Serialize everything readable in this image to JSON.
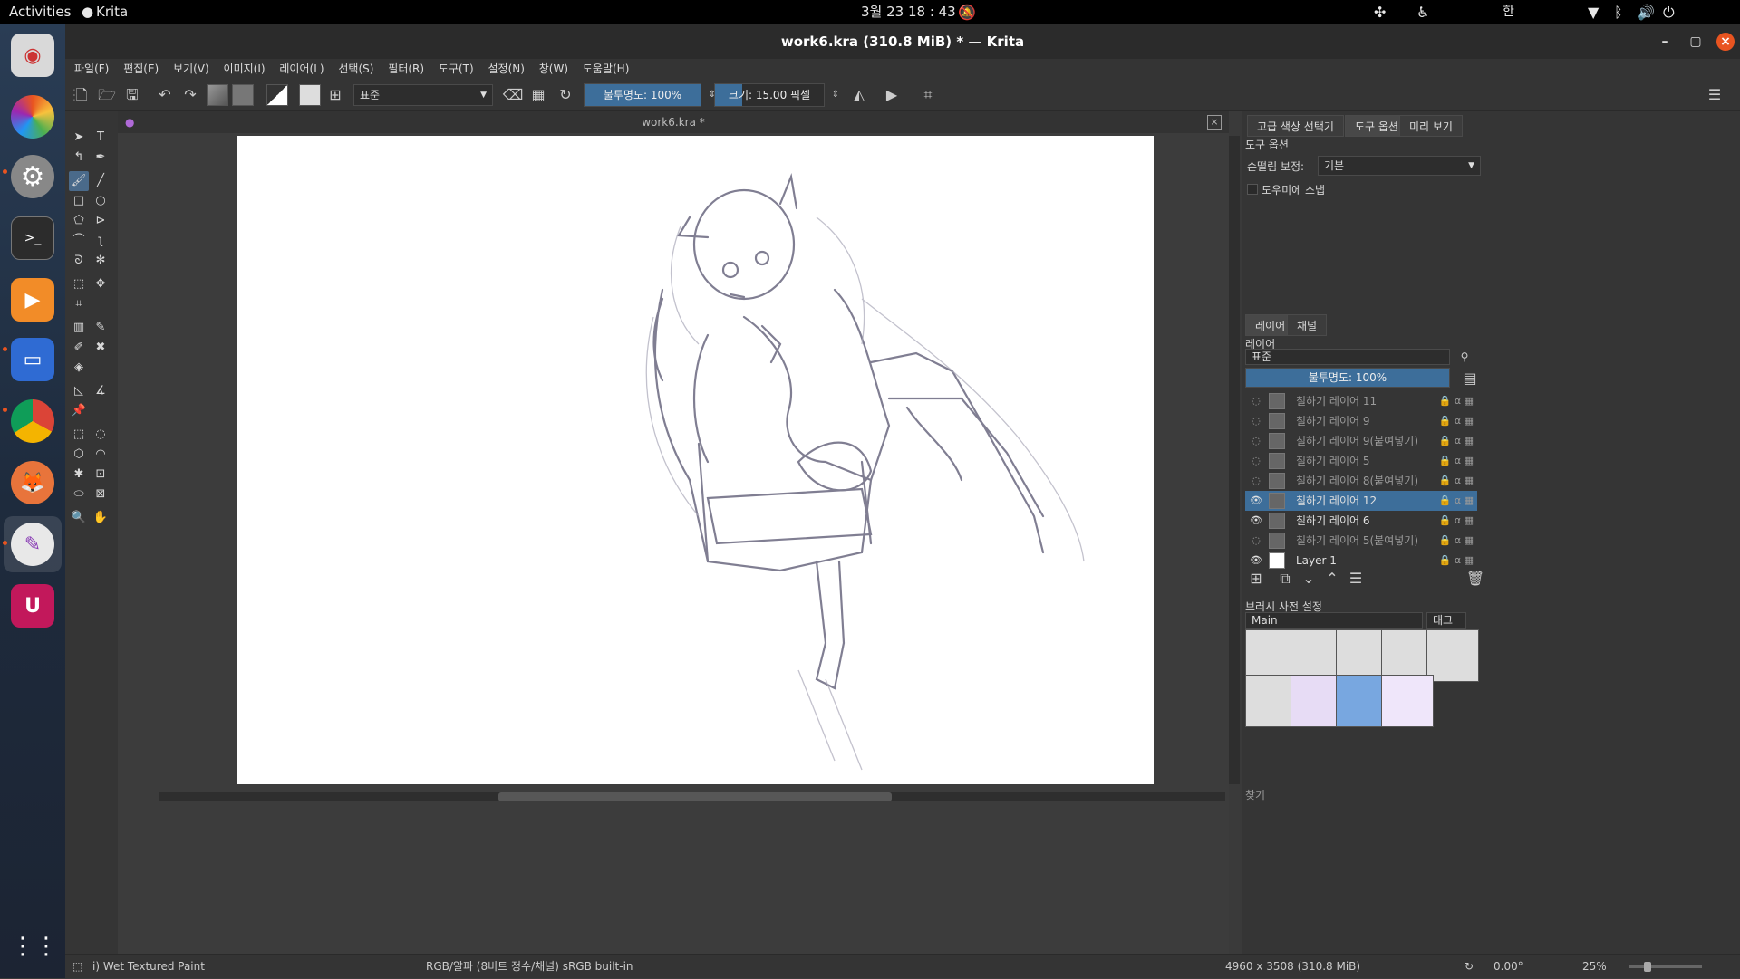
{
  "topbar": {
    "activities": "Activities",
    "app_name": "Krita",
    "datetime": "3월 23  18 : 43",
    "input_method": "한"
  },
  "window": {
    "title": "work6.kra (310.8 MiB)  * — Krita"
  },
  "menu": [
    "파일(F)",
    "편집(E)",
    "보기(V)",
    "이미지(I)",
    "레이어(L)",
    "선택(S)",
    "필터(R)",
    "도구(T)",
    "설정(N)",
    "창(W)",
    "도움말(H)"
  ],
  "toolbar": {
    "blend_mode": "표준",
    "opacity_label": "불투명도: 100%",
    "opacity_fraction": 1.0,
    "size_label": "크기: 15.00 픽셀",
    "size_fraction": 0.25
  },
  "canvas": {
    "tab_title": "work6.kra *"
  },
  "panels": {
    "tabs": [
      "고급 색상 선택기",
      "도구 옵션",
      "미리 보기"
    ],
    "tool_options_title": "도구 옵션",
    "smoothing_label": "손떨림 보정:",
    "smoothing_value": "기본",
    "snap_label": "도우미에 스냅",
    "layer_tabs": [
      "레이어",
      "채널"
    ],
    "layers_title": "레이어",
    "layers_blend": "표준",
    "layers_opacity": "불투명도:  100%",
    "layers": [
      {
        "name": "칠하기 레이어 11",
        "visible": false,
        "selected": false
      },
      {
        "name": "칠하기 레이어 9",
        "visible": false,
        "selected": false
      },
      {
        "name": "칠하기 레이어 9(붙여넣기)",
        "visible": false,
        "selected": false
      },
      {
        "name": "칠하기 레이어 5",
        "visible": false,
        "selected": false
      },
      {
        "name": "칠하기 레이어 8(붙여넣기)",
        "visible": false,
        "selected": false
      },
      {
        "name": "칠하기 레이어 12",
        "visible": true,
        "selected": true
      },
      {
        "name": "칠하기 레이어 6",
        "visible": true,
        "selected": false
      },
      {
        "name": "칠하기 레이어 5(붙여넣기)",
        "visible": false,
        "selected": false
      },
      {
        "name": "Layer 1",
        "visible": true,
        "selected": false
      }
    ],
    "brush_presets_title": "브러시 사전 설정",
    "brush_tag_combo": "Main",
    "brush_tag_button": "태그",
    "search_label": "찾기"
  },
  "status": {
    "brush": "i) Wet Textured Paint",
    "color_model": "RGB/알파 (8비트 정수/채널)  sRGB built-in",
    "dimensions": "4960 x 3508 (310.8 MiB)",
    "rotation": "0.00°",
    "zoom": "25%"
  }
}
